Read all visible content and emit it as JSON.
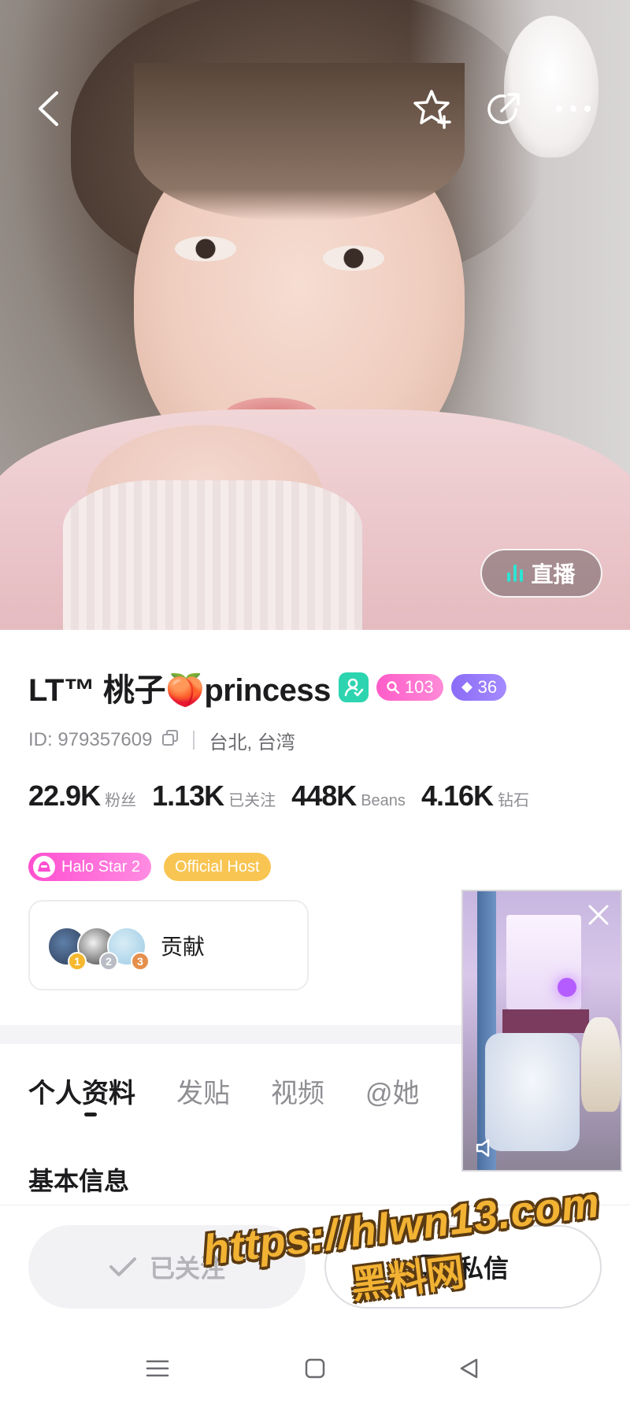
{
  "hero": {
    "live_button_label": "直播"
  },
  "profile": {
    "name": "LT™ 桃子🍑princess",
    "badges": {
      "level_pink": "103",
      "level_purple": "36"
    },
    "id_text": "ID: 979357609",
    "location": "台北, 台湾",
    "stats": [
      {
        "value": "22.9K",
        "label": "粉丝"
      },
      {
        "value": "1.13K",
        "label": "已关注"
      },
      {
        "value": "448K",
        "label": "Beans"
      },
      {
        "value": "4.16K",
        "label": "钻石"
      }
    ],
    "tags": {
      "halo": "Halo Star 2",
      "official": "Official Host"
    },
    "contribution": {
      "label": "贡献",
      "ranks": [
        "1",
        "2",
        "3"
      ]
    }
  },
  "tabs": [
    {
      "label": "个人资料",
      "active": true
    },
    {
      "label": "发贴",
      "active": false
    },
    {
      "label": "视频",
      "active": false
    },
    {
      "label": "@她",
      "active": false
    }
  ],
  "section_title": "基本信息",
  "actions": {
    "following_label": "已关注",
    "message_label": "私信"
  },
  "watermark": {
    "line1": "https://hlwn13.com",
    "line2": "黑料网"
  },
  "colors": {
    "accent_teal": "#2dd4b0",
    "live_bars": "#2ee3d2",
    "badge_pink": "#ff5cc8",
    "badge_purple": "#8b6cf6",
    "official_orange": "#f8c552",
    "watermark_orange": "#f2b233"
  }
}
